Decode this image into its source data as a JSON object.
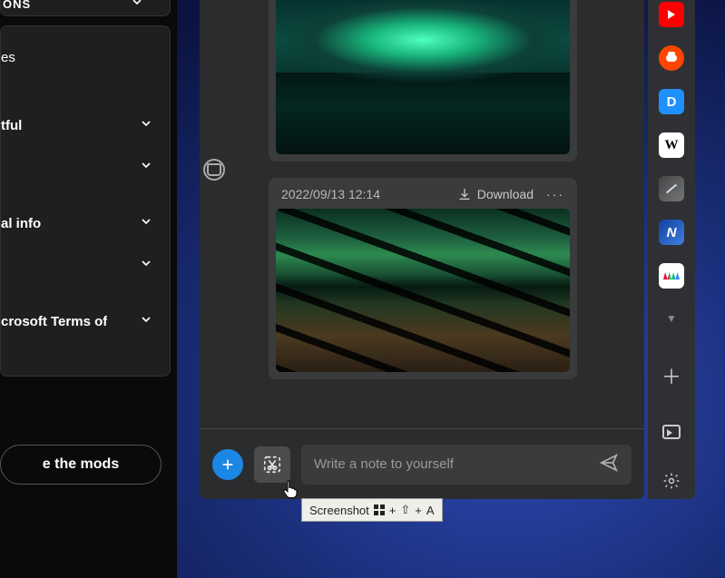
{
  "left_panel": {
    "top_section_label": "ONS",
    "rows": [
      {
        "label": "es"
      },
      {
        "label": "tful"
      },
      {
        "label": ""
      },
      {
        "label": "al info"
      },
      {
        "label": ""
      },
      {
        "label": "crosoft Terms of"
      }
    ],
    "mods_button": "e the mods"
  },
  "notes": {
    "cards": [
      {
        "timestamp": "",
        "download_label": "",
        "image": "aurora-lake"
      },
      {
        "timestamp": "2022/09/13 12:14",
        "download_label": "Download",
        "image": "bridge"
      }
    ]
  },
  "compose": {
    "placeholder": "Write a note to yourself"
  },
  "tooltip": {
    "prefix": "Screenshot",
    "plus": "+",
    "shift": "⇧",
    "key": "A"
  },
  "side_apps": {
    "disqus_letter": "D",
    "wiki_letter": "W",
    "n_letter": "N"
  }
}
